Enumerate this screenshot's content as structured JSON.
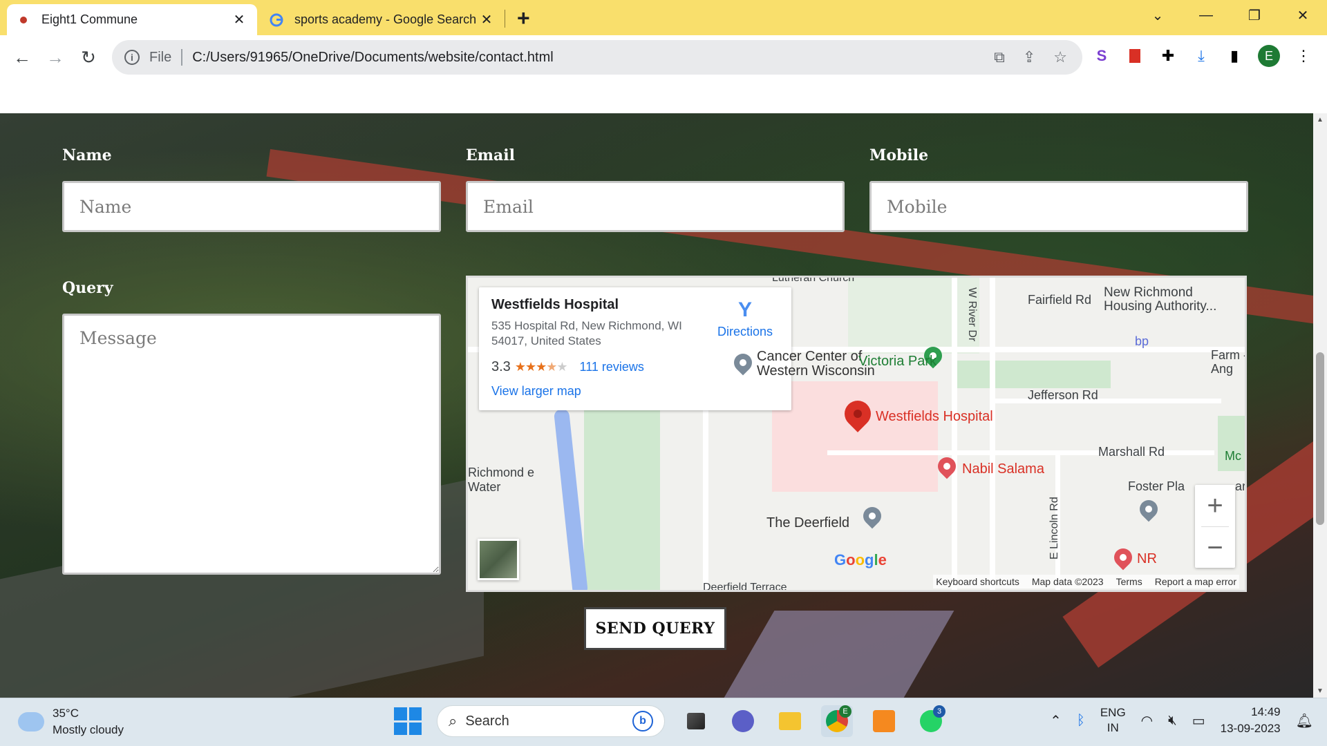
{
  "browser": {
    "tabs": [
      {
        "title": "Eight1 Commune",
        "active": true,
        "close": "✕"
      },
      {
        "title": "sports academy - Google Search",
        "active": false,
        "close": "✕"
      }
    ],
    "new_tab": "+",
    "window_controls": [
      "⌄",
      "—",
      "❐",
      "✕"
    ],
    "address": {
      "scheme_label": "File",
      "url": "C:/Users/91965/OneDrive/Documents/website/contact.html"
    },
    "profile_initial": "E"
  },
  "form": {
    "name_label": "Name",
    "name_placeholder": "Name",
    "email_label": "Email",
    "email_placeholder": "Email",
    "mobile_label": "Mobile",
    "mobile_placeholder": "Mobile",
    "query_label": "Query",
    "message_placeholder": "Message",
    "send_label": "SEND QUERY"
  },
  "map": {
    "place_title": "Westfields Hospital",
    "address": "535 Hospital Rd, New Richmond, WI 54017, United States",
    "rating": "3.3",
    "stars": 3.3,
    "reviews": "111 reviews",
    "larger_map": "View larger map",
    "directions": "Directions",
    "labels": {
      "lutheran": "Lutheran Church",
      "fairfield": "Fairfield Rd",
      "w_river": "W River Dr",
      "new_richmond_housing": "New Richmond Housing Authority...",
      "bp": "bp",
      "farm": "Farm - Ang",
      "cancer_center": "Cancer Center of Western Wisconsin",
      "victoria_park": "Victoria Park",
      "jefferson": "Jefferson Rd",
      "westfields": "Westfields Hospital",
      "marshall": "Marshall Rd",
      "mc": "Mc",
      "nabil": "Nabil Salama",
      "richmond_water": "Richmond e Water",
      "foster": "Foster Pla",
      "ar": "ar",
      "lincoln": "E Lincoln Rd",
      "deerfield": "The Deerfield",
      "nr": "NR",
      "deerfield_terrace": "Deerfield Terrace"
    },
    "google": "Google",
    "footer": [
      "Keyboard shortcuts",
      "Map data ©2023",
      "Terms",
      "Report a map error"
    ]
  },
  "taskbar": {
    "temperature": "35°C",
    "weather": "Mostly cloudy",
    "search": "Search",
    "lang_top": "ENG",
    "lang_bottom": "IN",
    "time": "14:49",
    "date": "13-09-2023",
    "chrome_badge": "E",
    "whatsapp_badge": "3"
  }
}
